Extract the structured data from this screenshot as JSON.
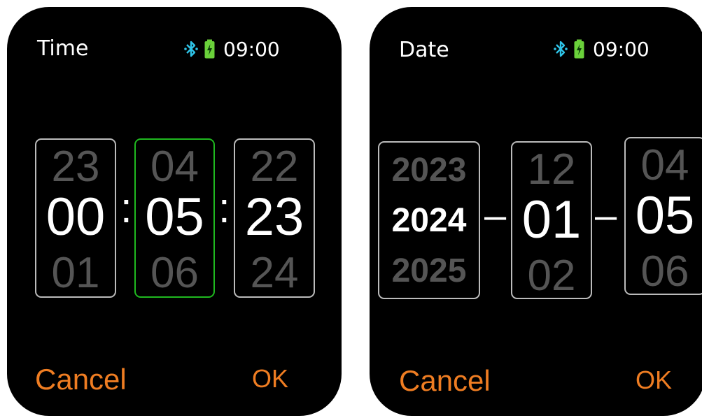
{
  "colors": {
    "accent": "#ef7d22",
    "selected_border": "#1fb81f",
    "bluetooth": "#2fc4e8",
    "battery": "#6ad13a",
    "dim_text": "#555555"
  },
  "status_bar": {
    "icons": [
      "bluetooth-icon",
      "battery-icon"
    ],
    "clock": "09:00"
  },
  "time_screen": {
    "title": "Time",
    "hour": {
      "prev": "23",
      "value": "00",
      "next": "01"
    },
    "minute": {
      "prev": "04",
      "value": "05",
      "next": "06"
    },
    "second": {
      "prev": "22",
      "value": "23",
      "next": "24"
    },
    "separator": ":",
    "cancel_label": "Cancel",
    "ok_label": "OK"
  },
  "date_screen": {
    "title": "Date",
    "year": {
      "prev": "2023",
      "value": "2024",
      "next": "2025"
    },
    "month": {
      "prev": "12",
      "value": "01",
      "next": "02"
    },
    "day": {
      "prev": "04",
      "value": "05",
      "next": "06"
    },
    "separator": "–",
    "cancel_label": "Cancel",
    "ok_label": "OK"
  }
}
